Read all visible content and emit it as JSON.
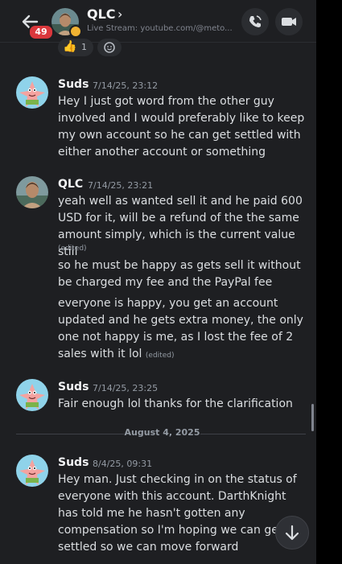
{
  "header": {
    "channel_name": "QLC",
    "subtitle": "Live Stream: youtube.com/@meto...",
    "unread_badge": "49"
  },
  "reactions": [
    {
      "icon": "thumbs-up-icon",
      "count": "1"
    },
    {
      "icon": "add-reaction-icon",
      "count": ""
    }
  ],
  "messages": [
    {
      "author": "Suds",
      "timestamp": "7/14/25, 23:12",
      "lines": [
        "Hey I just got word from the other guy involved and I would preferably like to keep my own account so he can get settled with either another account or something"
      ]
    },
    {
      "author": "QLC",
      "timestamp": "7/14/25, 23:21",
      "line1": "yeah well as wanted sell it and he paid 600 USD for it, will be a refund of the the same amount simply, which is the current value still",
      "line2": "so he must be happy as gets sell it without be charged my fee and the PayPal fee",
      "line3": "everyone is happy, you get an account updated and he gets extra money, the only one not happy is me, as I lost the fee of 2 sales with it lol",
      "edited_label": "(edited)"
    },
    {
      "author": "Suds",
      "timestamp": "7/14/25, 23:25",
      "lines": [
        "Fair enough lol thanks for the clarification"
      ]
    },
    {
      "author": "Suds",
      "timestamp": "8/4/25, 09:31",
      "lines": [
        "Hey man. Just checking in on the status of everyone with this account. DarthKnight has told me he hasn't gotten any compensation so I'm hoping we can get it settled so we can move forward"
      ]
    }
  ],
  "date_divider": "August 4, 2025",
  "colors": {
    "background": "#1e1f22",
    "badge": "#da373c",
    "status_idle": "#f0b232"
  }
}
